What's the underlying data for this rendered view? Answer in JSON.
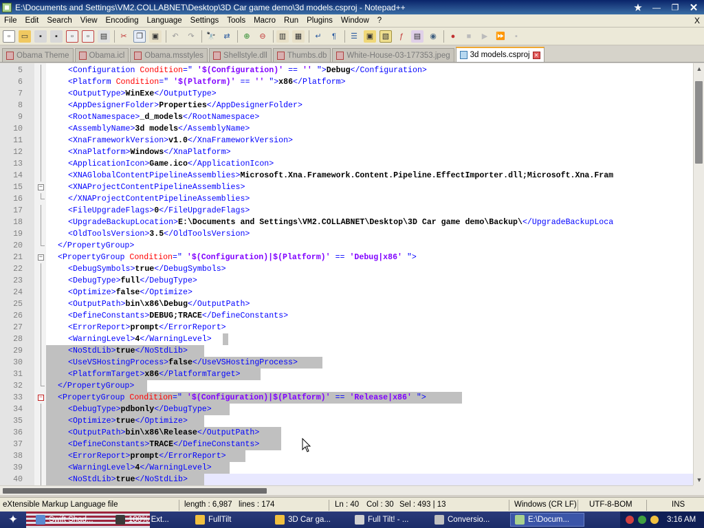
{
  "window": {
    "title": "E:\\Documents and Settings\\VM2.COLLABNET\\Desktop\\3D Car game demo\\3d models.csproj - Notepad++",
    "controls": [
      "★",
      "—",
      "❐",
      "✕"
    ]
  },
  "menu": [
    "File",
    "Edit",
    "Search",
    "View",
    "Encoding",
    "Language",
    "Settings",
    "Tools",
    "Macro",
    "Run",
    "Plugins",
    "Window",
    "?"
  ],
  "menu_close": "X",
  "tabs": [
    {
      "label": "Obama Theme",
      "active": false
    },
    {
      "label": "Obama.icl",
      "active": false
    },
    {
      "label": "Obama.msstyles",
      "active": false
    },
    {
      "label": "Shellstyle.dll",
      "active": false
    },
    {
      "label": "Thumbs.db",
      "active": false
    },
    {
      "label": "White-House-03-177353.jpeg",
      "active": false
    },
    {
      "label": "3d models.csproj",
      "active": true
    }
  ],
  "editor": {
    "lines": [
      {
        "n": "5",
        "indent": 2,
        "parts": [
          [
            "tag",
            "<Configuration "
          ],
          [
            "attr",
            "Condition"
          ],
          [
            "tag",
            "=\" "
          ],
          [
            "val",
            "'$(Configuration)'"
          ],
          [
            "tag",
            " == "
          ],
          [
            "val",
            "''"
          ],
          [
            "tag",
            " \">"
          ],
          [
            "text",
            "Debug"
          ],
          [
            "tag",
            "</Configuration>"
          ]
        ]
      },
      {
        "n": "6",
        "indent": 2,
        "parts": [
          [
            "tag",
            "<Platform "
          ],
          [
            "attr",
            "Condition"
          ],
          [
            "tag",
            "=\" "
          ],
          [
            "val",
            "'$(Platform)'"
          ],
          [
            "tag",
            " == "
          ],
          [
            "val",
            "''"
          ],
          [
            "tag",
            " \">"
          ],
          [
            "text",
            "x86"
          ],
          [
            "tag",
            "</Platform>"
          ]
        ]
      },
      {
        "n": "7",
        "indent": 2,
        "parts": [
          [
            "tag",
            "<OutputType>"
          ],
          [
            "text",
            "WinExe"
          ],
          [
            "tag",
            "</OutputType>"
          ]
        ]
      },
      {
        "n": "8",
        "indent": 2,
        "parts": [
          [
            "tag",
            "<AppDesignerFolder>"
          ],
          [
            "text",
            "Properties"
          ],
          [
            "tag",
            "</AppDesignerFolder>"
          ]
        ]
      },
      {
        "n": "9",
        "indent": 2,
        "parts": [
          [
            "tag",
            "<RootNamespace>"
          ],
          [
            "text",
            "_d_models"
          ],
          [
            "tag",
            "</RootNamespace>"
          ]
        ]
      },
      {
        "n": "10",
        "indent": 2,
        "parts": [
          [
            "tag",
            "<AssemblyName>"
          ],
          [
            "text",
            "3d models"
          ],
          [
            "tag",
            "</AssemblyName>"
          ]
        ]
      },
      {
        "n": "11",
        "indent": 2,
        "parts": [
          [
            "tag",
            "<XnaFrameworkVersion>"
          ],
          [
            "text",
            "v1.0"
          ],
          [
            "tag",
            "</XnaFrameworkVersion>"
          ]
        ]
      },
      {
        "n": "12",
        "indent": 2,
        "parts": [
          [
            "tag",
            "<XnaPlatform>"
          ],
          [
            "text",
            "Windows"
          ],
          [
            "tag",
            "</XnaPlatform>"
          ]
        ]
      },
      {
        "n": "13",
        "indent": 2,
        "parts": [
          [
            "tag",
            "<ApplicationIcon>"
          ],
          [
            "text",
            "Game.ico"
          ],
          [
            "tag",
            "</ApplicationIcon>"
          ]
        ]
      },
      {
        "n": "14",
        "indent": 2,
        "parts": [
          [
            "tag",
            "<XNAGlobalContentPipelineAssemblies>"
          ],
          [
            "text",
            "Microsoft.Xna.Framework.Content.Pipeline.EffectImporter.dll;Microsoft.Xna.Fram"
          ]
        ]
      },
      {
        "n": "15",
        "indent": 2,
        "fold": "box",
        "parts": [
          [
            "tag",
            "<XNAProjectContentPipelineAssemblies>"
          ]
        ]
      },
      {
        "n": "16",
        "indent": 2,
        "fold": "end",
        "parts": [
          [
            "tag",
            "</XNAProjectContentPipelineAssemblies>"
          ]
        ]
      },
      {
        "n": "17",
        "indent": 2,
        "parts": [
          [
            "tag",
            "<FileUpgradeFlags>"
          ],
          [
            "text",
            "0"
          ],
          [
            "tag",
            "</FileUpgradeFlags>"
          ]
        ]
      },
      {
        "n": "18",
        "indent": 2,
        "parts": [
          [
            "tag",
            "<UpgradeBackupLocation>"
          ],
          [
            "text",
            "E:\\Documents and Settings\\VM2.COLLABNET\\Desktop\\3D Car game demo\\Backup\\"
          ],
          [
            "tag",
            "</UpgradeBackupLoca"
          ]
        ]
      },
      {
        "n": "19",
        "indent": 2,
        "parts": [
          [
            "tag",
            "<OldToolsVersion>"
          ],
          [
            "text",
            "3.5"
          ],
          [
            "tag",
            "</OldToolsVersion>"
          ]
        ]
      },
      {
        "n": "20",
        "indent": 1,
        "fold": "end",
        "parts": [
          [
            "tag",
            "</PropertyGroup>"
          ]
        ]
      },
      {
        "n": "21",
        "indent": 1,
        "fold": "box",
        "parts": [
          [
            "tag",
            "<PropertyGroup "
          ],
          [
            "attr",
            "Condition"
          ],
          [
            "tag",
            "=\" "
          ],
          [
            "val",
            "'$(Configuration)|$(Platform)'"
          ],
          [
            "tag",
            " == "
          ],
          [
            "val",
            "'Debug|x86'"
          ],
          [
            "tag",
            " \">"
          ]
        ]
      },
      {
        "n": "22",
        "indent": 2,
        "parts": [
          [
            "tag",
            "<DebugSymbols>"
          ],
          [
            "text",
            "true"
          ],
          [
            "tag",
            "</DebugSymbols>"
          ]
        ]
      },
      {
        "n": "23",
        "indent": 2,
        "parts": [
          [
            "tag",
            "<DebugType>"
          ],
          [
            "text",
            "full"
          ],
          [
            "tag",
            "</DebugType>"
          ]
        ]
      },
      {
        "n": "24",
        "indent": 2,
        "parts": [
          [
            "tag",
            "<Optimize>"
          ],
          [
            "text",
            "false"
          ],
          [
            "tag",
            "</Optimize>"
          ]
        ]
      },
      {
        "n": "25",
        "indent": 2,
        "parts": [
          [
            "tag",
            "<OutputPath>"
          ],
          [
            "text",
            "bin\\x86\\Debug"
          ],
          [
            "tag",
            "</OutputPath>"
          ]
        ]
      },
      {
        "n": "26",
        "indent": 2,
        "parts": [
          [
            "tag",
            "<DefineConstants>"
          ],
          [
            "text",
            "DEBUG;TRACE"
          ],
          [
            "tag",
            "</DefineConstants>"
          ]
        ]
      },
      {
        "n": "27",
        "indent": 2,
        "parts": [
          [
            "tag",
            "<ErrorReport>"
          ],
          [
            "text",
            "prompt"
          ],
          [
            "tag",
            "</ErrorReport>"
          ]
        ]
      },
      {
        "n": "28",
        "indent": 2,
        "selstart": true,
        "parts": [
          [
            "tag",
            "<WarningLevel>"
          ],
          [
            "text",
            "4"
          ],
          [
            "tag",
            "</WarningLevel>"
          ]
        ]
      },
      {
        "n": "29",
        "indent": 2,
        "sel": true,
        "parts": [
          [
            "tag",
            "<NoStdLib>"
          ],
          [
            "text",
            "true"
          ],
          [
            "tag",
            "</NoStdLib>"
          ]
        ]
      },
      {
        "n": "30",
        "indent": 2,
        "sel": true,
        "parts": [
          [
            "tag",
            "<UseVSHostingProcess>"
          ],
          [
            "text",
            "false"
          ],
          [
            "tag",
            "</UseVSHostingProcess>"
          ]
        ]
      },
      {
        "n": "31",
        "indent": 2,
        "sel": true,
        "parts": [
          [
            "tag",
            "<PlatformTarget>"
          ],
          [
            "text",
            "x86"
          ],
          [
            "tag",
            "</PlatformTarget>"
          ]
        ]
      },
      {
        "n": "32",
        "indent": 1,
        "sel": true,
        "fold": "end",
        "parts": [
          [
            "tag",
            "</PropertyGroup>"
          ]
        ]
      },
      {
        "n": "33",
        "indent": 1,
        "sel": true,
        "fold": "boxred",
        "parts": [
          [
            "tag",
            "<PropertyGroup "
          ],
          [
            "attr",
            "Condition"
          ],
          [
            "tag",
            "=\" "
          ],
          [
            "val",
            "'$(Configuration)|$(Platform)'"
          ],
          [
            "tag",
            " == "
          ],
          [
            "val",
            "'Release|x86'"
          ],
          [
            "tag",
            " \">"
          ]
        ]
      },
      {
        "n": "34",
        "indent": 2,
        "sel": true,
        "parts": [
          [
            "tag",
            "<DebugType>"
          ],
          [
            "text",
            "pdbonly"
          ],
          [
            "tag",
            "</DebugType>"
          ]
        ]
      },
      {
        "n": "35",
        "indent": 2,
        "sel": true,
        "parts": [
          [
            "tag",
            "<Optimize>"
          ],
          [
            "text",
            "true"
          ],
          [
            "tag",
            "</Optimize>"
          ]
        ]
      },
      {
        "n": "36",
        "indent": 2,
        "sel": true,
        "parts": [
          [
            "tag",
            "<OutputPath>"
          ],
          [
            "text",
            "bin\\x86\\Release"
          ],
          [
            "tag",
            "</OutputPath>"
          ]
        ]
      },
      {
        "n": "37",
        "indent": 2,
        "sel": true,
        "parts": [
          [
            "tag",
            "<DefineConstants>"
          ],
          [
            "text",
            "TRACE"
          ],
          [
            "tag",
            "</DefineConstants>"
          ]
        ]
      },
      {
        "n": "38",
        "indent": 2,
        "sel": true,
        "parts": [
          [
            "tag",
            "<ErrorReport>"
          ],
          [
            "text",
            "prompt"
          ],
          [
            "tag",
            "</ErrorReport>"
          ]
        ]
      },
      {
        "n": "39",
        "indent": 2,
        "sel": true,
        "parts": [
          [
            "tag",
            "<WarningLevel>"
          ],
          [
            "text",
            "4"
          ],
          [
            "tag",
            "</WarningLevel>"
          ]
        ]
      },
      {
        "n": "40",
        "indent": 2,
        "sel": true,
        "current": true,
        "parts": [
          [
            "tag",
            "<NoStdLib>"
          ],
          [
            "text",
            "true"
          ],
          [
            "tag",
            "</NoStdLib>"
          ]
        ]
      }
    ]
  },
  "status": {
    "filetype": "eXtensible Markup Language file",
    "length": "length : 6,987",
    "lines": "lines : 174",
    "ln": "Ln : 40",
    "col": "Col : 30",
    "sel": "Sel : 493 | 13",
    "eol": "Windows (CR LF)",
    "encoding": "UTF-8-BOM",
    "mode": "INS"
  },
  "taskbar": {
    "tasks": [
      {
        "label": "Swift Shad...",
        "color": "#5a8ad0",
        "active": false
      },
      {
        "label": "100% Ext...",
        "color": "#3a3a3a",
        "active": false
      },
      {
        "label": "FullTilt",
        "color": "#f0c040",
        "active": false
      },
      {
        "label": "3D Car ga...",
        "color": "#f0c040",
        "active": false
      },
      {
        "label": "Full Tilt! - ...",
        "color": "#d0d0d0",
        "active": false
      },
      {
        "label": "Conversio...",
        "color": "#c0c0c0",
        "active": false
      },
      {
        "label": "E:\\Docum...",
        "color": "#a9d18e",
        "active": true
      }
    ],
    "clock": "3:16 AM"
  },
  "colors": {
    "tag": "#0000ff",
    "attr": "#ff0000",
    "value": "#8000ff",
    "selection": "#c0c0c0",
    "active_tab_accent": "#f0a830"
  }
}
